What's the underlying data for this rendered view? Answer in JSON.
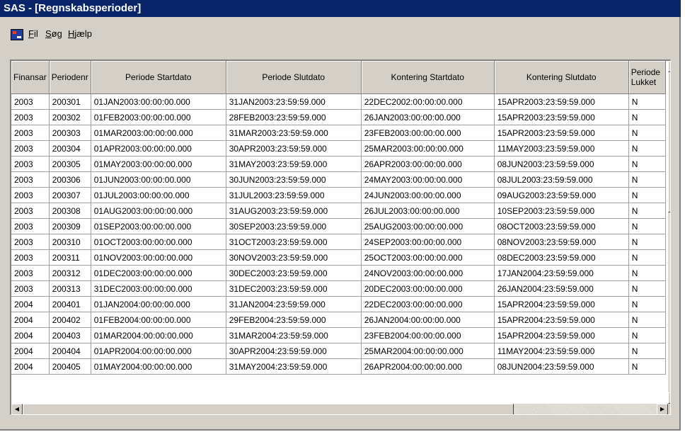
{
  "window": {
    "title": "SAS - [Regnskabsperioder]"
  },
  "menu": {
    "icon": "sas-app-icon",
    "items": [
      {
        "acc": "F",
        "rest": "il"
      },
      {
        "acc": "S",
        "rest": "øg"
      },
      {
        "acc": "H",
        "rest": "jælp"
      }
    ]
  },
  "table": {
    "columns": [
      "Finansar",
      "Periodenr",
      "Periode Startdato",
      "Periode Slutdato",
      "Kontering Startdato",
      "Kontering Slutdato",
      "Periode Lukket"
    ],
    "rows": [
      [
        "2003",
        "200301",
        "01JAN2003:00:00:00.000",
        "31JAN2003:23:59:59.000",
        "22DEC2002:00:00:00.000",
        "15APR2003:23:59:59.000",
        "N"
      ],
      [
        "2003",
        "200302",
        "01FEB2003:00:00:00.000",
        "28FEB2003:23:59:59.000",
        "26JAN2003:00:00:00.000",
        "15APR2003:23:59:59.000",
        "N"
      ],
      [
        "2003",
        "200303",
        "01MAR2003:00:00:00.000",
        "31MAR2003:23:59:59.000",
        "23FEB2003:00:00:00.000",
        "15APR2003:23:59:59.000",
        "N"
      ],
      [
        "2003",
        "200304",
        "01APR2003:00:00:00.000",
        "30APR2003:23:59:59.000",
        "25MAR2003:00:00:00.000",
        "11MAY2003:23:59:59.000",
        "N"
      ],
      [
        "2003",
        "200305",
        "01MAY2003:00:00:00.000",
        "31MAY2003:23:59:59.000",
        "26APR2003:00:00:00.000",
        "08JUN2003:23:59:59.000",
        "N"
      ],
      [
        "2003",
        "200306",
        "01JUN2003:00:00:00.000",
        "30JUN2003:23:59:59.000",
        "24MAY2003:00:00:00.000",
        "08JUL2003:23:59:59.000",
        "N"
      ],
      [
        "2003",
        "200307",
        "01JUL2003:00:00:00.000",
        "31JUL2003:23:59:59.000",
        "24JUN2003:00:00:00.000",
        "09AUG2003:23:59:59.000",
        "N"
      ],
      [
        "2003",
        "200308",
        "01AUG2003:00:00:00.000",
        "31AUG2003:23:59:59.000",
        "26JUL2003:00:00:00.000",
        "10SEP2003:23:59:59.000",
        "N"
      ],
      [
        "2003",
        "200309",
        "01SEP2003:00:00:00.000",
        "30SEP2003:23:59:59.000",
        "25AUG2003:00:00:00.000",
        "08OCT2003:23:59:59.000",
        "N"
      ],
      [
        "2003",
        "200310",
        "01OCT2003:00:00:00.000",
        "31OCT2003:23:59:59.000",
        "24SEP2003:00:00:00.000",
        "08NOV2003:23:59:59.000",
        "N"
      ],
      [
        "2003",
        "200311",
        "01NOV2003:00:00:00.000",
        "30NOV2003:23:59:59.000",
        "25OCT2003:00:00:00.000",
        "08DEC2003:23:59:59.000",
        "N"
      ],
      [
        "2003",
        "200312",
        "01DEC2003:00:00:00.000",
        "30DEC2003:23:59:59.000",
        "24NOV2003:00:00:00.000",
        "17JAN2004:23:59:59.000",
        "N"
      ],
      [
        "2003",
        "200313",
        "31DEC2003:00:00:00.000",
        "31DEC2003:23:59:59.000",
        "20DEC2003:00:00:00.000",
        "26JAN2004:23:59:59.000",
        "N"
      ],
      [
        "2004",
        "200401",
        "01JAN2004:00:00:00.000",
        "31JAN2004:23:59:59.000",
        "22DEC2003:00:00:00.000",
        "15APR2004:23:59:59.000",
        "N"
      ],
      [
        "2004",
        "200402",
        "01FEB2004:00:00:00.000",
        "29FEB2004:23:59:59.000",
        "26JAN2004:00:00:00.000",
        "15APR2004:23:59:59.000",
        "N"
      ],
      [
        "2004",
        "200403",
        "01MAR2004:00:00:00.000",
        "31MAR2004:23:59:59.000",
        "23FEB2004:00:00:00.000",
        "15APR2004:23:59:59.000",
        "N"
      ],
      [
        "2004",
        "200404",
        "01APR2004:00:00:00.000",
        "30APR2004:23:59:59.000",
        "25MAR2004:00:00:00.000",
        "11MAY2004:23:59:59.000",
        "N"
      ],
      [
        "2004",
        "200405",
        "01MAY2004:00:00:00.000",
        "31MAY2004:23:59:59.000",
        "26APR2004:00:00:00.000",
        "08JUN2004:23:59:59.000",
        "N"
      ]
    ]
  },
  "scrollbars": {
    "up": "▲",
    "down": "▼",
    "left": "◀",
    "right": "▶"
  }
}
